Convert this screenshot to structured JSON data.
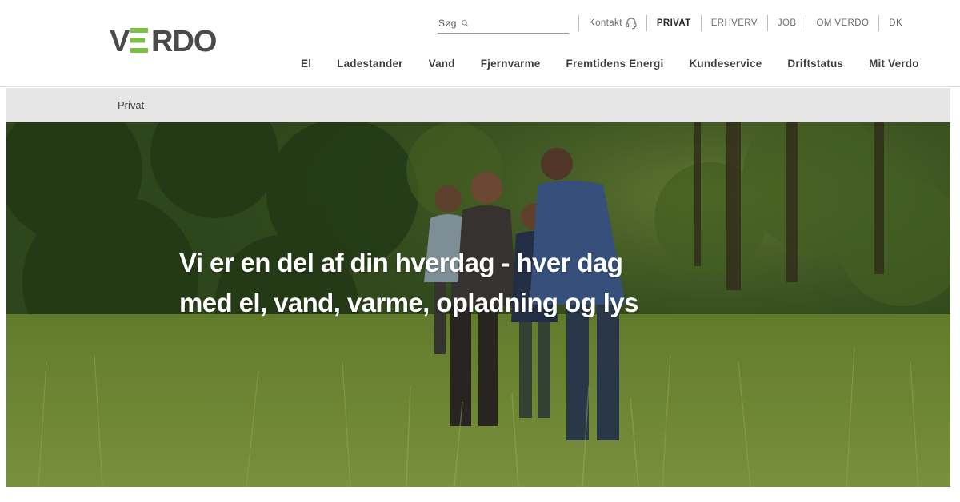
{
  "brand": {
    "name": "VERDO",
    "accent_color": "#7ac143",
    "text_color": "#4a4a4a"
  },
  "utility": {
    "search_label": "Søg",
    "search_placeholder": "",
    "links": [
      {
        "label": "Kontakt",
        "icon": "headset-icon",
        "active": false
      },
      {
        "label": "PRIVAT",
        "active": true
      },
      {
        "label": "ERHVERV",
        "active": false
      },
      {
        "label": "JOB",
        "active": false
      },
      {
        "label": "OM VERDO",
        "active": false
      },
      {
        "label": "DK",
        "active": false
      }
    ]
  },
  "nav": {
    "items": [
      "El",
      "Ladestander",
      "Vand",
      "Fjernvarme",
      "Fremtidens Energi",
      "Kundeservice",
      "Driftstatus",
      "Mit Verdo"
    ]
  },
  "breadcrumb": {
    "current": "Privat"
  },
  "hero": {
    "headline_line1": "Vi er en del af din hverdag - hver dag",
    "headline_line2": "med el, vand, varme, opladning og lys",
    "image": "family-in-meadow-photo"
  }
}
